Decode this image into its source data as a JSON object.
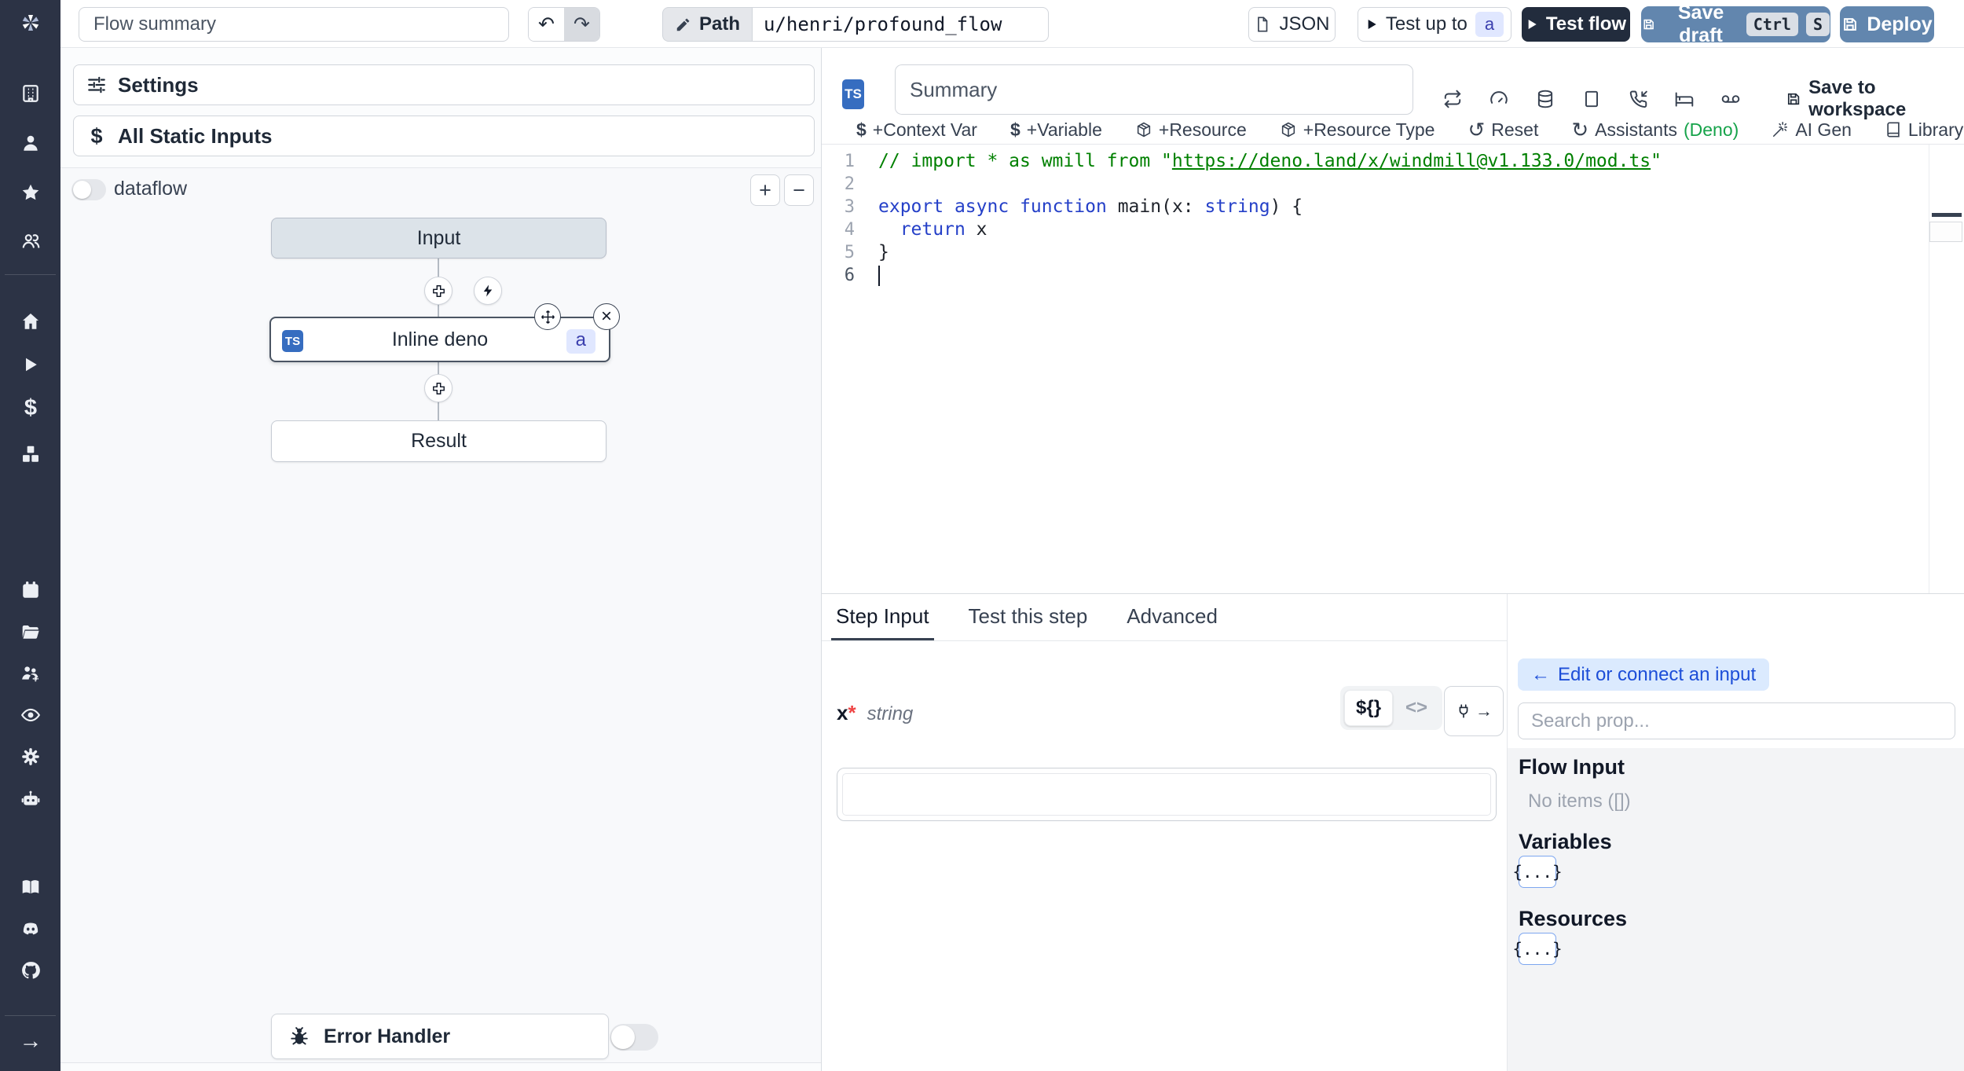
{
  "topbar": {
    "summary_placeholder": "Flow summary",
    "path_label": "Path",
    "path_value": "u/henri/profound_flow",
    "json_label": "JSON",
    "test_up_to_label": "Test up to",
    "test_up_to_badge": "a",
    "test_flow_label": "Test flow",
    "save_draft_label": "Save draft",
    "kbd_ctrl": "Ctrl",
    "kbd_s": "S",
    "deploy_label": "Deploy"
  },
  "sidebar": {
    "icons": [
      "windmill-logo",
      "workspace",
      "user",
      "favorites",
      "groups",
      "home",
      "runs",
      "variables",
      "resources",
      "schedules",
      "folders",
      "workers",
      "audit-logs",
      "settings",
      "ai",
      "docs",
      "discord",
      "github",
      "expand"
    ]
  },
  "flow_panel": {
    "settings_label": "Settings",
    "all_static_inputs_label": "All Static Inputs",
    "dataflow_label": "dataflow",
    "zoom_in_label": "+",
    "zoom_out_label": "−",
    "input_node_label": "Input",
    "step_node": {
      "lang_badge": "TS",
      "label": "Inline deno",
      "id_badge": "a"
    },
    "result_node_label": "Result",
    "error_handler_label": "Error Handler"
  },
  "editor_panel": {
    "lang_badge": "TS",
    "summary_placeholder": "Summary",
    "save_to_workspace_label": "Save to workspace",
    "actions": {
      "context_var": "+Context Var",
      "variable": "+Variable",
      "resource": "+Resource",
      "resource_type": "+Resource Type",
      "reset": "Reset",
      "assistants": "Assistants",
      "assistants_lang": "(Deno)",
      "ai_gen": "AI Gen",
      "library": "Library"
    },
    "code": {
      "lines": [
        {
          "no": "1",
          "tokens": [
            {
              "t": "// import * as wmill from \"",
              "c": "comment"
            },
            {
              "t": "https://deno.land/x/windmill@v1.133.0/mod.ts",
              "c": "comment-link"
            },
            {
              "t": "\"",
              "c": "comment"
            }
          ]
        },
        {
          "no": "2",
          "tokens": []
        },
        {
          "no": "3",
          "tokens": [
            {
              "t": "export",
              "c": "kw"
            },
            {
              "t": " ",
              "c": "plain"
            },
            {
              "t": "async",
              "c": "kw"
            },
            {
              "t": " ",
              "c": "plain"
            },
            {
              "t": "function",
              "c": "kw"
            },
            {
              "t": " ",
              "c": "plain"
            },
            {
              "t": "main",
              "c": "fn"
            },
            {
              "t": "(x: ",
              "c": "plain"
            },
            {
              "t": "string",
              "c": "kw"
            },
            {
              "t": ") {",
              "c": "plain"
            }
          ]
        },
        {
          "no": "4",
          "tokens": [
            {
              "t": "  ",
              "c": "plain"
            },
            {
              "t": "return",
              "c": "kw"
            },
            {
              "t": " x",
              "c": "plain"
            }
          ]
        },
        {
          "no": "5",
          "tokens": [
            {
              "t": "}",
              "c": "plain"
            }
          ]
        },
        {
          "no": "6",
          "tokens": [],
          "cursor": true,
          "active": true
        }
      ]
    }
  },
  "step_panel": {
    "tabs": {
      "step_input": "Step Input",
      "test_this_step": "Test this step",
      "advanced": "Advanced"
    },
    "field": {
      "name": "x",
      "required": "*",
      "type": "string"
    },
    "editor_toggle": {
      "template": "${}",
      "code": "<>"
    },
    "connect": {
      "back_arrow": "←",
      "back_label": "Edit or connect an input",
      "search_placeholder": "Search prop...",
      "flow_input_title": "Flow Input",
      "flow_input_empty": "No items ([])",
      "variables_title": "Variables",
      "variables_button": "{...}",
      "resources_title": "Resources",
      "resources_button": "{...}"
    }
  },
  "icons": {
    "undo": "↶",
    "redo": "↷",
    "reset": "↺",
    "assistants": "↻",
    "dollar": "$",
    "play": "▶",
    "close": "×",
    "arrow_right": "→",
    "plug_arrow": "→",
    "plus": "+",
    "minus": "−"
  },
  "colors": {
    "sidebar_bg": "#2c3345",
    "primary_button": "#6286ae",
    "dark_button": "#222c3d",
    "badge_bg": "#e0e7ff",
    "badge_text": "#3b3fae",
    "ts_badge": "#366dc0",
    "green_dot": "#4ade80",
    "deno_green": "#16a34a",
    "comment_green": "#008000",
    "keyword_blue": "#2540c8"
  }
}
